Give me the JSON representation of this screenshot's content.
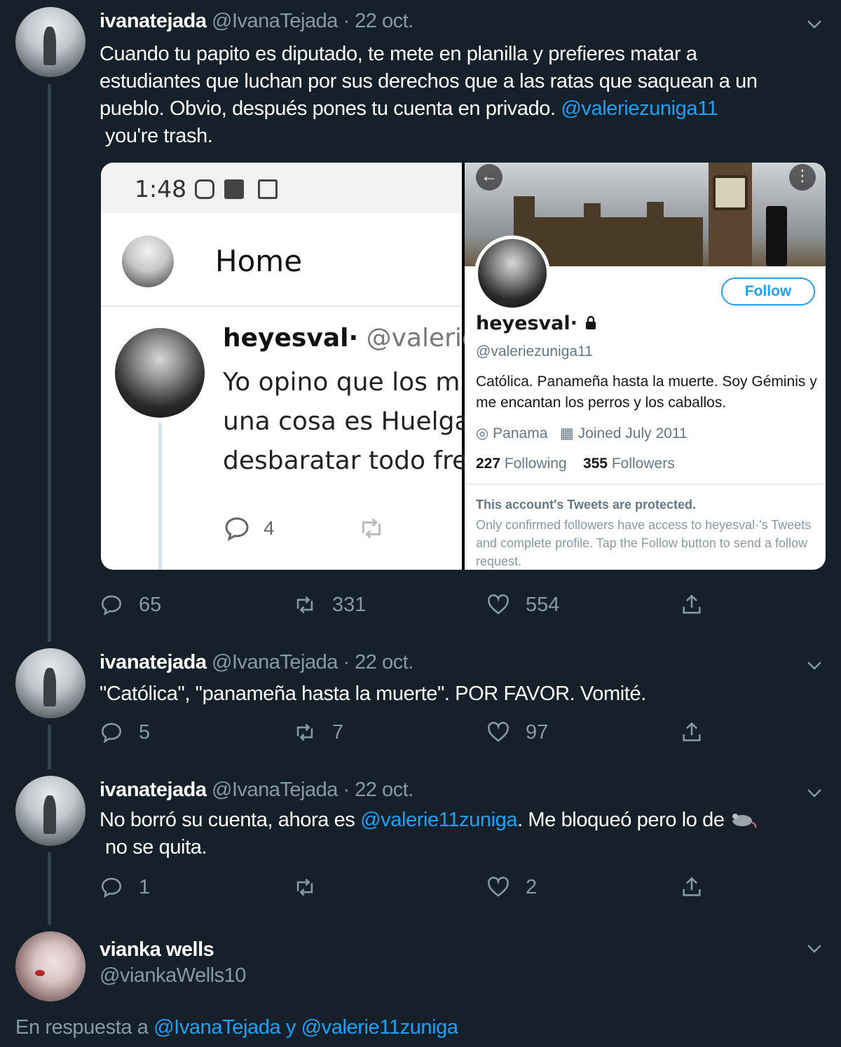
{
  "colors": {
    "background": "#15202b",
    "accent": "#1da1f2",
    "muted": "#8899a6",
    "thread_line": "#38444d"
  },
  "tweets": [
    {
      "name": "ivanatejada",
      "handle": "@IvanaTejada · 22 oct.",
      "text_lines": [
        "Cuando tu papito es diputado, te mete en planilla y prefieres matar a",
        "estudiantes que luchan por sus derechos que a las ratas que saquean a un",
        "pueblo. Obvio, después pones tu cuenta en privado. "
      ],
      "mention": "@valeriezuniga11",
      "text_tail": " you're trash.",
      "replies": "65",
      "retweets": "331",
      "likes": "554"
    },
    {
      "name": "ivanatejada",
      "handle": "@IvanaTejada · 22 oct.",
      "text": "\"Católica\", \"panameña hasta la muerte\". POR FAVOR. Vomité.",
      "replies": "5",
      "retweets": "7",
      "likes": "97"
    },
    {
      "name": "ivanatejada",
      "handle": "@IvanaTejada · 22 oct.",
      "text_before": "No borró su cuenta, ahora es ",
      "mention": "@valerie11zuniga",
      "text_after": ". Me bloqueó pero lo de ",
      "text_tail": " no se quita.",
      "replies": "1",
      "retweets": "",
      "likes": "2"
    },
    {
      "name": "vianka wells",
      "handle": "@viankaWells10"
    }
  ],
  "embedded": {
    "left": {
      "time": "1:48",
      "home_title": "Home",
      "tweet_name": "heyesval·",
      "tweet_handle": "@valerie",
      "tweet_lines": [
        "Yo opino que los m",
        "una cosa es Huelga",
        "desbaratar todo fre"
      ],
      "reply_count": "4"
    },
    "right": {
      "follow": "Follow",
      "name": "heyesval·",
      "handle": "@valeriezuniga11",
      "bio": "Católica. Panameña hasta la muerte. Soy Géminis y me encantan los perros y los caballos.",
      "location": "Panama",
      "joined": "Joined July 2011",
      "following_count": "227",
      "following_label": "Following",
      "followers_count": "355",
      "followers_label": "Followers",
      "protected_title": "This account's Tweets are protected.",
      "protected_text": "Only confirmed followers have access to heyesval·'s Tweets and complete profile. Tap the Follow button to send a follow request."
    }
  },
  "reply_to": {
    "prefix": "En respuesta a ",
    "user1": "@IvanaTejada",
    "joiner": " y ",
    "user2": "@valerie11zuniga"
  },
  "icons": {
    "reply": "reply-icon",
    "retweet": "retweet-icon",
    "like": "heart-icon",
    "share": "share-icon",
    "chevron": "chevron-down-icon",
    "rat": "rat-emoji-icon",
    "lock": "lock-icon"
  }
}
